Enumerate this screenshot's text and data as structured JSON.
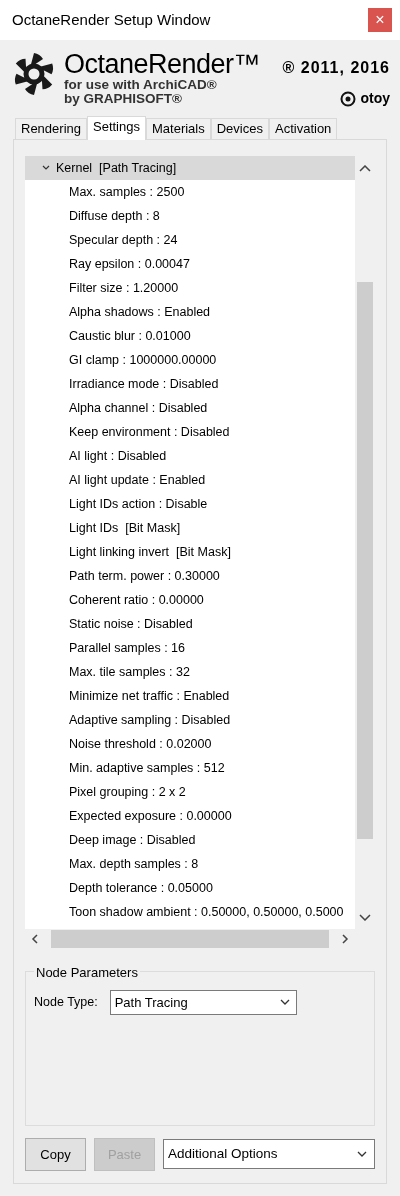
{
  "window": {
    "title": "OctaneRender Setup Window",
    "close": "×"
  },
  "header": {
    "product": "OctaneRender™",
    "copyright": "® 2011, 2016",
    "line1": "for use with ArchiCAD®",
    "line2": "by GRAPHISOFT®",
    "vendor": "otoy"
  },
  "tabs": [
    {
      "label": "Rendering",
      "selected": false
    },
    {
      "label": "Settings",
      "selected": true
    },
    {
      "label": "Materials",
      "selected": false
    },
    {
      "label": "Devices",
      "selected": false
    },
    {
      "label": "Activation",
      "selected": false
    }
  ],
  "tree": [
    {
      "label": "Kernel  [Path Tracing]",
      "expanded": true,
      "selected": true,
      "children": [
        {
          "label": "Max. samples : 2500"
        },
        {
          "label": "Diffuse depth : 8"
        },
        {
          "label": "Specular depth : 24"
        },
        {
          "label": "Ray epsilon : 0.00047"
        },
        {
          "label": "Filter size : 1.20000"
        },
        {
          "label": "Alpha shadows : Enabled"
        },
        {
          "label": "Caustic blur : 0.01000"
        },
        {
          "label": "GI clamp : 1000000.00000"
        },
        {
          "label": "Irradiance mode : Disabled"
        },
        {
          "label": "Alpha channel : Disabled"
        },
        {
          "label": "Keep environment : Disabled"
        },
        {
          "label": "AI light : Disabled"
        },
        {
          "label": "AI light update : Enabled"
        },
        {
          "label": "Light IDs action : Disable"
        },
        {
          "label": "Light IDs  [Bit Mask]"
        },
        {
          "label": "Light linking invert  [Bit Mask]"
        },
        {
          "label": "Path term. power : 0.30000"
        },
        {
          "label": "Coherent ratio : 0.00000"
        },
        {
          "label": "Static noise : Disabled"
        },
        {
          "label": "Parallel samples : 16"
        },
        {
          "label": "Max. tile samples : 32"
        },
        {
          "label": "Minimize net traffic : Enabled"
        },
        {
          "label": "Adaptive sampling : Disabled"
        },
        {
          "label": "Noise threshold : 0.02000"
        },
        {
          "label": "Min. adaptive samples : 512"
        },
        {
          "label": "Pixel grouping : 2 x 2"
        },
        {
          "label": "Expected exposure : 0.00000"
        },
        {
          "label": "Deep image : Disabled"
        },
        {
          "label": "Max. depth samples : 8"
        },
        {
          "label": "Depth tolerance : 0.05000"
        },
        {
          "label": "Toon shadow ambient : 0.50000, 0.50000, 0.5000"
        }
      ]
    }
  ],
  "node_parameters": {
    "title": "Node Parameters",
    "label": "Node Type:",
    "value": "Path Tracing"
  },
  "buttons": [
    {
      "label": "Copy",
      "disabled": false
    },
    {
      "label": "Paste",
      "disabled": true
    }
  ],
  "options": {
    "value": "Additional Options"
  }
}
